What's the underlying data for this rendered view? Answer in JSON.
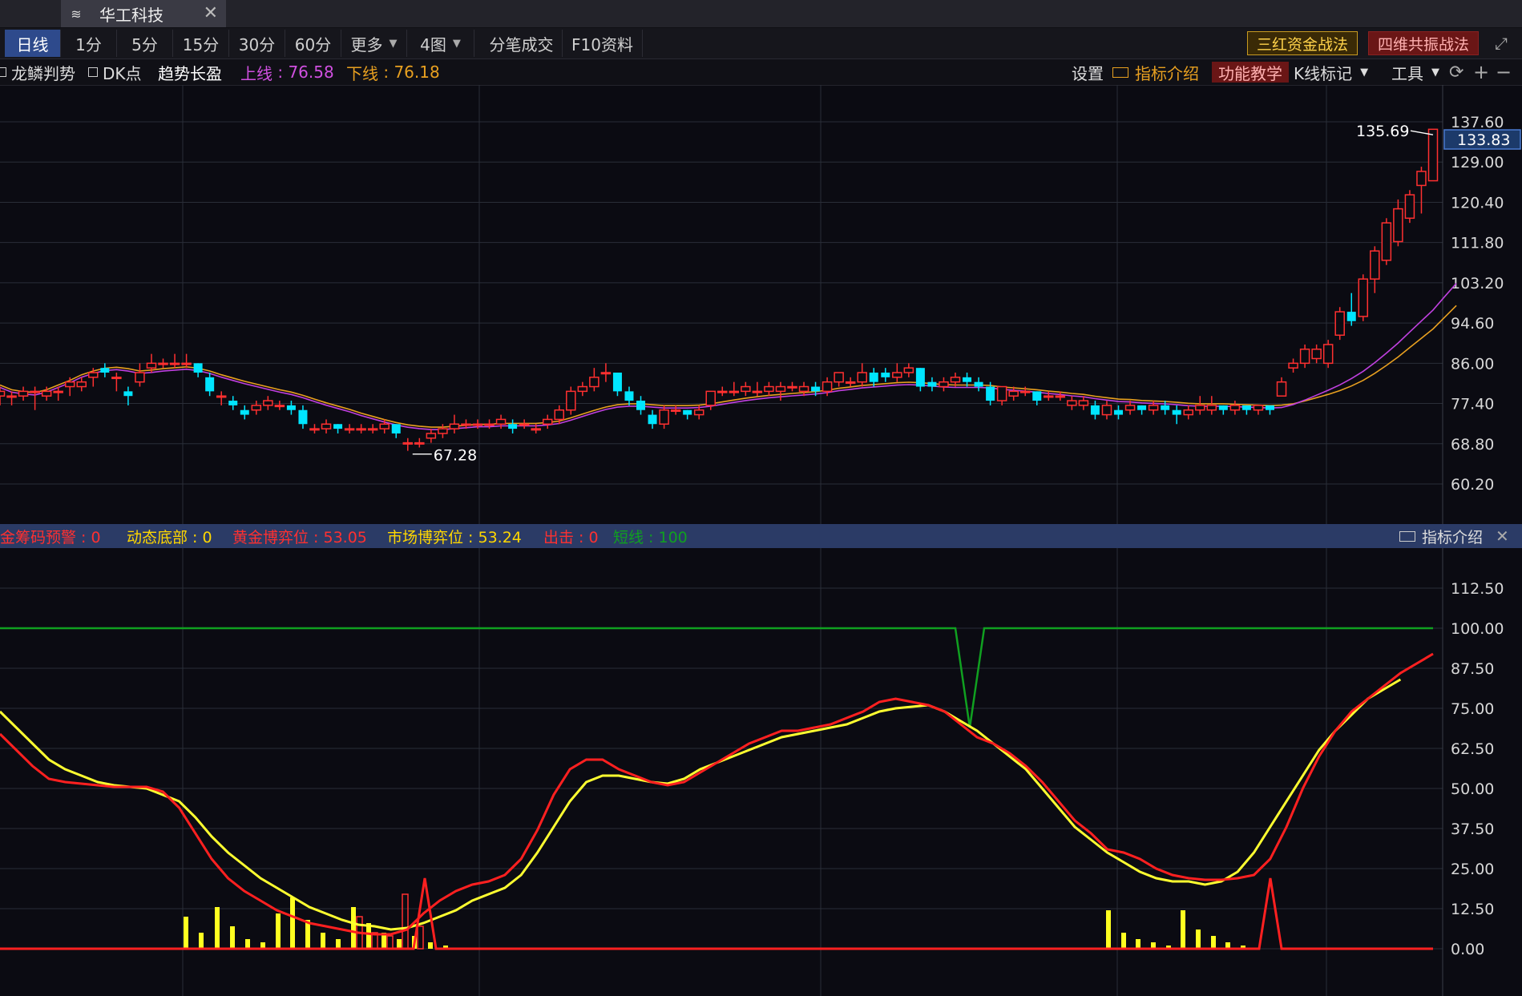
{
  "tab": {
    "title": "华工科技",
    "close": "✕"
  },
  "periods": [
    {
      "label": "日线"
    },
    {
      "label": "1分"
    },
    {
      "label": "5分"
    },
    {
      "label": "15分"
    },
    {
      "label": "30分"
    },
    {
      "label": "60分"
    },
    {
      "label": "更多"
    },
    {
      "label": "4图"
    },
    {
      "label": "分笔成交"
    },
    {
      "label": "F10资料"
    }
  ],
  "strategies": {
    "a": "三红资金战法",
    "b": "四维共振战法"
  },
  "indicators": {
    "longlin": "龙鳞判势",
    "dk": "DK点",
    "trend": "趋势长盈",
    "upper_label": "上线",
    "upper_value": "76.58",
    "lower_label": "下线",
    "lower_value": "76.18"
  },
  "right_tools": {
    "settings": "设置",
    "intro": "指标介绍",
    "teach": "功能教学",
    "kmark": "K线标记",
    "tools": "工具",
    "refresh": "⟳",
    "plus": "+",
    "minus": "−"
  },
  "sub_indicator": {
    "items": [
      {
        "label": "金筹码预警",
        "value": "0",
        "color": "#ff3030"
      },
      {
        "label": "动态底部",
        "value": "0",
        "color": "#ffd700"
      },
      {
        "label": "黄金博弈位",
        "value": "53.05",
        "color": "#ff3030"
      },
      {
        "label": "市场博弈位",
        "value": "53.24",
        "color": "#ffd700"
      },
      {
        "label": "出击",
        "value": "0",
        "color": "#ff3030"
      },
      {
        "label": "短线",
        "value": "100",
        "color": "#10a020"
      }
    ],
    "intro": "指标介绍",
    "close": "✕"
  },
  "chart_data": [
    {
      "type": "candlestick",
      "y_ticks": [
        137.6,
        129.0,
        120.4,
        111.8,
        103.2,
        94.6,
        86.0,
        77.4,
        68.8,
        60.2
      ],
      "current_price": "133.83",
      "high_mark": "135.69",
      "low_mark": "67.28",
      "ylim": [
        55,
        140
      ],
      "candles": [
        [
          79,
          80,
          77,
          81
        ],
        [
          79,
          79,
          77,
          80
        ],
        [
          79,
          80,
          78,
          81
        ],
        [
          80,
          80,
          76,
          81
        ],
        [
          79,
          80,
          78,
          81
        ],
        [
          80,
          80,
          78,
          81
        ],
        [
          81,
          82,
          79,
          83
        ],
        [
          81,
          82,
          80,
          83
        ],
        [
          83,
          84,
          81,
          85
        ],
        [
          85,
          84,
          83,
          86
        ],
        [
          83,
          83,
          80,
          84
        ],
        [
          80,
          79,
          77,
          81
        ],
        [
          82,
          84,
          81,
          86
        ],
        [
          85,
          86,
          84,
          88
        ],
        [
          86,
          86,
          85,
          87
        ],
        [
          86,
          86,
          85,
          88
        ],
        [
          86,
          86,
          85,
          88
        ],
        [
          86,
          84,
          83,
          86
        ],
        [
          83,
          80,
          79,
          84
        ],
        [
          79,
          79,
          77,
          80
        ],
        [
          78,
          77,
          76,
          79
        ],
        [
          76,
          75,
          74,
          77
        ],
        [
          76,
          77,
          75,
          78
        ],
        [
          77,
          78,
          76,
          79
        ],
        [
          77,
          77,
          76,
          78
        ],
        [
          77,
          76,
          75,
          78
        ],
        [
          76,
          73,
          72,
          77
        ],
        [
          72,
          72,
          71,
          73
        ],
        [
          72,
          73,
          71,
          74
        ],
        [
          73,
          72,
          71,
          73
        ],
        [
          72,
          72,
          71,
          73
        ],
        [
          72,
          72,
          71,
          73
        ],
        [
          72,
          72,
          71,
          73
        ],
        [
          72,
          73,
          71,
          74
        ],
        [
          73,
          71,
          70,
          73
        ],
        [
          69,
          69,
          67.28,
          70
        ],
        [
          69,
          69,
          68,
          70
        ],
        [
          70,
          71,
          69,
          72
        ],
        [
          71,
          72,
          70,
          73
        ],
        [
          72,
          73,
          71,
          75
        ],
        [
          73,
          73,
          72,
          74
        ],
        [
          73,
          73,
          72,
          74
        ],
        [
          73,
          73,
          72,
          74
        ],
        [
          73,
          74,
          72,
          75
        ],
        [
          73,
          72,
          71,
          74
        ],
        [
          73,
          73,
          72,
          74
        ],
        [
          72,
          72,
          71,
          73
        ],
        [
          73,
          74,
          72,
          75
        ],
        [
          74,
          76,
          73,
          77
        ],
        [
          76,
          80,
          75,
          81
        ],
        [
          80,
          81,
          79,
          82
        ],
        [
          81,
          83,
          80,
          85
        ],
        [
          84,
          84,
          82,
          86
        ],
        [
          84,
          80,
          79,
          84
        ],
        [
          80,
          78,
          77,
          81
        ],
        [
          78,
          76,
          75,
          79
        ],
        [
          75,
          73,
          72,
          76
        ],
        [
          73,
          76,
          72,
          77
        ],
        [
          76,
          76,
          75,
          77
        ],
        [
          76,
          75,
          74,
          76
        ],
        [
          75,
          76,
          74,
          77
        ],
        [
          77,
          80,
          76,
          80
        ],
        [
          80,
          80,
          79,
          81
        ],
        [
          80,
          80,
          79,
          82
        ],
        [
          80,
          81,
          79,
          82
        ],
        [
          80,
          80,
          79,
          82
        ],
        [
          80,
          81,
          79,
          82
        ],
        [
          80,
          81,
          78,
          82
        ],
        [
          81,
          81,
          80,
          82
        ],
        [
          80,
          81,
          79,
          82
        ],
        [
          81,
          80,
          79,
          82
        ],
        [
          80,
          82,
          79,
          83
        ],
        [
          82,
          84,
          81,
          84
        ],
        [
          82,
          82,
          81,
          83
        ],
        [
          82,
          84,
          81,
          86
        ],
        [
          84,
          82,
          81,
          85
        ],
        [
          84,
          83,
          82,
          85
        ],
        [
          83,
          84,
          82,
          86
        ],
        [
          84,
          85,
          83,
          86
        ],
        [
          85,
          81,
          80,
          85
        ],
        [
          82,
          81,
          80,
          83
        ],
        [
          81,
          82,
          80,
          83
        ],
        [
          82,
          83,
          81,
          84
        ],
        [
          83,
          82,
          81,
          84
        ],
        [
          82,
          81,
          80,
          83
        ],
        [
          81,
          78,
          77,
          82
        ],
        [
          78,
          81,
          77,
          81
        ],
        [
          79,
          80,
          78,
          81
        ],
        [
          80,
          80,
          79,
          81
        ],
        [
          80,
          78,
          77,
          80
        ],
        [
          79,
          79,
          78,
          80
        ],
        [
          79,
          79,
          78,
          80
        ],
        [
          77,
          78,
          76,
          79
        ],
        [
          77,
          78,
          76,
          79
        ],
        [
          77,
          75,
          74,
          78
        ],
        [
          75,
          77,
          74,
          78
        ],
        [
          76,
          75,
          74,
          77
        ],
        [
          76,
          77,
          75,
          78
        ],
        [
          77,
          76,
          75,
          77
        ],
        [
          76,
          77,
          75,
          78
        ],
        [
          77,
          76,
          75,
          78
        ],
        [
          76,
          75,
          73,
          77
        ],
        [
          75,
          76,
          74,
          77
        ],
        [
          76,
          77,
          75,
          79
        ],
        [
          76,
          77,
          75,
          79
        ],
        [
          77,
          76,
          75,
          77
        ],
        [
          76,
          77,
          75,
          78
        ],
        [
          77,
          76,
          75,
          77
        ],
        [
          76,
          77,
          75,
          77
        ],
        [
          77,
          76,
          75,
          77
        ],
        [
          79,
          82,
          79,
          83
        ],
        [
          85,
          86,
          84,
          87
        ],
        [
          86,
          89,
          85,
          90
        ],
        [
          87,
          89,
          86,
          90
        ],
        [
          86,
          90,
          85,
          91
        ],
        [
          92,
          97,
          91,
          98
        ],
        [
          97,
          95,
          94,
          101
        ],
        [
          96,
          104,
          95,
          105
        ],
        [
          104,
          110,
          101,
          111
        ],
        [
          108,
          116,
          107,
          117
        ],
        [
          112,
          119,
          111,
          121
        ],
        [
          117,
          122,
          116,
          123
        ],
        [
          124,
          127,
          118,
          128
        ],
        [
          125,
          136,
          125,
          136
        ]
      ],
      "ma_fast": [
        81,
        80,
        79.6,
        79.4,
        80,
        81,
        82,
        83.2,
        84,
        84.6,
        84.8,
        84.5,
        84,
        84.2,
        84.5,
        84.7,
        84.9,
        84.6,
        84,
        83.2,
        82.5,
        81.8,
        81.2,
        80.6,
        80,
        79.5,
        78.8,
        78,
        77.2,
        76.5,
        75.8,
        75,
        74.3,
        73.6,
        73,
        72.5,
        72.2,
        72,
        72,
        72.2,
        72.4,
        72.6,
        72.6,
        72.8,
        72.8,
        72.8,
        72.8,
        73,
        73.3,
        74,
        74.8,
        75.6,
        76.3,
        76.8,
        77,
        77,
        76.8,
        76.6,
        76.6,
        76.6,
        76.7,
        77,
        77.4,
        77.8,
        78.2,
        78.5,
        78.8,
        79,
        79.2,
        79.4,
        79.6,
        79.9,
        80.3,
        80.6,
        80.9,
        81.1,
        81.3,
        81.5,
        81.6,
        81.5,
        81.3,
        81.1,
        81,
        81,
        81,
        80.9,
        80.6,
        80.4,
        80.2,
        80,
        79.7,
        79.5,
        79.2,
        79,
        78.6,
        78.3,
        78,
        77.9,
        77.7,
        77.6,
        77.5,
        77.3,
        77.1,
        77,
        77,
        77,
        76.9,
        76.8,
        76.7,
        76.6,
        76.7,
        77,
        77.6,
        78.3,
        79,
        79.8,
        80.8,
        82,
        83.5,
        85.2,
        87,
        89,
        91,
        93,
        95.5,
        98
      ]
    },
    {
      "type": "line",
      "y_ticks": [
        112.5,
        100.0,
        87.5,
        75.0,
        62.5,
        50.0,
        37.5,
        25.0,
        12.5,
        0.0
      ],
      "ylim": [
        -8,
        120
      ],
      "red": [
        67,
        62,
        57,
        53,
        52,
        51.5,
        51,
        50.5,
        50.5,
        50.5,
        49,
        44,
        36,
        28,
        22,
        18,
        15,
        12,
        10,
        8,
        7,
        6,
        5,
        4.5,
        4.5,
        6,
        11,
        15,
        18,
        20,
        21,
        23,
        28,
        37,
        48,
        56,
        59,
        59,
        56,
        54,
        52,
        51,
        52,
        55,
        58,
        61,
        64,
        66,
        68,
        68,
        69,
        70,
        72,
        74,
        77,
        78,
        77,
        76,
        74,
        70,
        66,
        64,
        61,
        57,
        52,
        46,
        40,
        36,
        31,
        30,
        28,
        25,
        23,
        22,
        21.5,
        21.5,
        22,
        23,
        28,
        38,
        50,
        60,
        68,
        74,
        78,
        82,
        86,
        89,
        92
      ],
      "yellow": [
        74,
        69,
        64,
        59,
        56,
        54,
        52,
        51,
        50.5,
        50,
        48,
        46,
        41,
        35,
        30,
        26,
        22,
        19,
        16,
        13,
        11,
        9,
        7.5,
        7,
        6,
        6.5,
        8,
        10,
        12,
        15,
        17,
        19,
        23,
        30,
        38,
        46,
        52,
        54,
        54,
        53,
        52,
        51.5,
        53,
        56,
        58,
        60,
        62,
        64,
        66,
        67,
        68,
        69,
        70,
        72,
        74,
        75,
        75.5,
        76,
        74,
        71,
        68,
        64,
        60,
        56,
        50,
        44,
        38,
        34,
        30,
        27,
        24,
        22,
        21,
        21,
        20,
        21,
        24,
        30,
        38,
        46,
        54,
        62,
        68,
        73,
        78,
        81,
        84
      ],
      "green_level": 100,
      "green_dip": [
        1210,
        69
      ],
      "bars_yellow": [
        [
          232,
          10
        ],
        [
          251,
          5
        ],
        [
          271,
          13
        ],
        [
          290,
          7
        ],
        [
          309,
          3
        ],
        [
          328,
          2
        ],
        [
          347,
          11
        ],
        [
          365,
          16
        ],
        [
          384,
          9
        ],
        [
          403,
          5
        ],
        [
          422,
          3
        ],
        [
          441,
          13
        ],
        [
          460,
          8
        ],
        [
          479,
          5
        ],
        [
          498,
          3
        ],
        [
          517,
          4
        ],
        [
          537,
          2
        ],
        [
          556,
          1
        ],
        [
          1383,
          12
        ],
        [
          1402,
          5
        ],
        [
          1420,
          3
        ],
        [
          1439,
          2
        ],
        [
          1458,
          1
        ],
        [
          1476,
          12
        ],
        [
          1495,
          6
        ],
        [
          1514,
          4
        ],
        [
          1532,
          2
        ],
        [
          1551,
          1
        ]
      ],
      "bars_red": [
        [
          441,
          10
        ],
        [
          460,
          5
        ],
        [
          479,
          4
        ],
        [
          498,
          17
        ],
        [
          517,
          7
        ]
      ],
      "spikes_red": [
        [
          530,
          22
        ],
        [
          1585,
          22
        ]
      ]
    }
  ]
}
